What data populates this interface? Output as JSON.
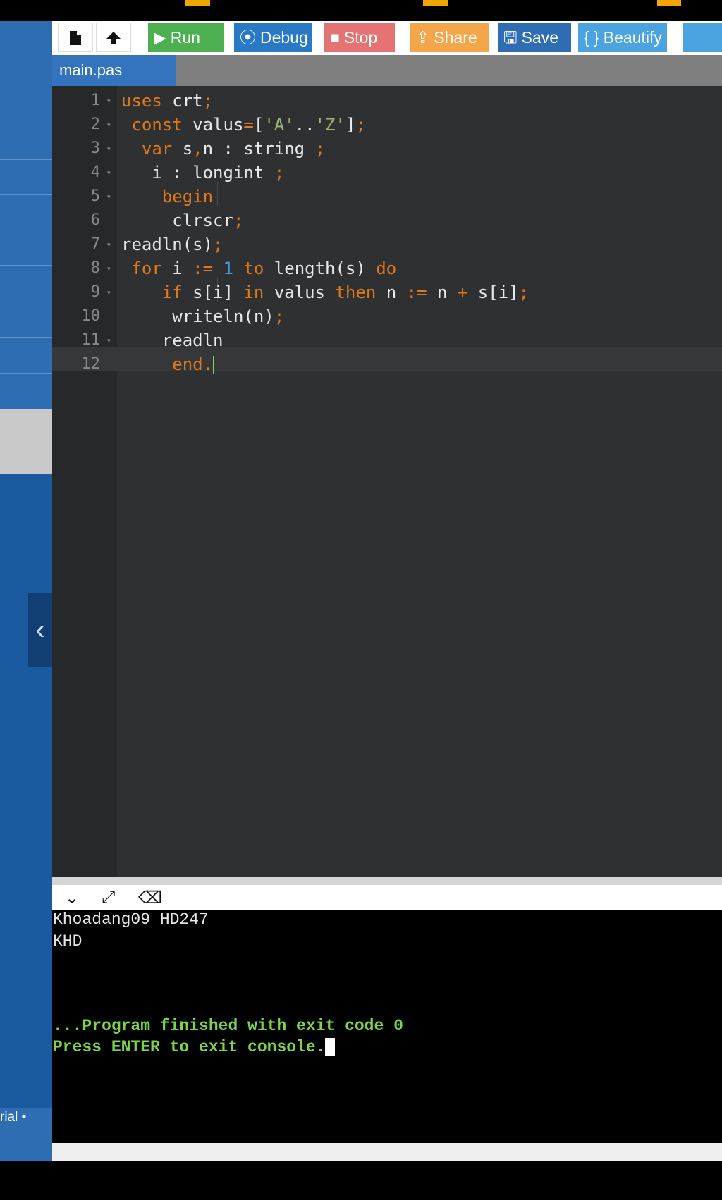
{
  "toolbar": {
    "new_file_icon": "file-icon",
    "upload_icon": "upload-icon",
    "run": {
      "icon": "▶",
      "label": "Run",
      "color": "#4caf50"
    },
    "debug": {
      "icon": "⦿",
      "label": "Debug",
      "color": "#2a79c7"
    },
    "stop": {
      "icon": "■",
      "label": "Stop",
      "color": "#e57373"
    },
    "share": {
      "icon": "⇪",
      "label": "Share",
      "color": "#f5a54a"
    },
    "save": {
      "icon": "🖫",
      "label": "Save",
      "color": "#2f6db3"
    },
    "beautify": {
      "icon": "{ }",
      "label": "Beautify",
      "color": "#4ba3e0"
    }
  },
  "tabs": [
    {
      "label": "main.pas",
      "active": true
    }
  ],
  "editor": {
    "line_numbers": [
      "1",
      "2",
      "3",
      "4",
      "5",
      "6",
      "7",
      "8",
      "9",
      "10",
      "11",
      "12"
    ],
    "foldable": [
      true,
      true,
      true,
      true,
      true,
      false,
      true,
      true,
      true,
      false,
      true,
      false
    ],
    "lines": [
      "uses crt;",
      " const valus=['A'..'Z'];",
      "  var s,n : string ;",
      "   i : longint ;",
      "    begin",
      "     clrscr;",
      "readln(s);",
      " for i := 1 to length(s) do",
      "    if s[i] in valus then n := n + s[i];",
      "     writeln(n);",
      "    readln",
      "     end."
    ],
    "active_line": 12
  },
  "console": {
    "header_icons": [
      "chevron-down-icon",
      "expand-icon",
      "clear-console-icon"
    ],
    "output": [
      "Khoadang09 HD247",
      "KHD"
    ],
    "finished": "...Program finished with exit code 0",
    "prompt": "Press ENTER to exit console."
  },
  "sidebar": {
    "collapse_glyph": "‹",
    "tail_label": "rial •"
  },
  "colors": {
    "sidebar": "#2f6db3",
    "editor_bg": "#2f3032",
    "keyword": "#e0791b",
    "string": "#9fb87a",
    "number": "#4d97e3",
    "console_green": "#7cd34a"
  }
}
